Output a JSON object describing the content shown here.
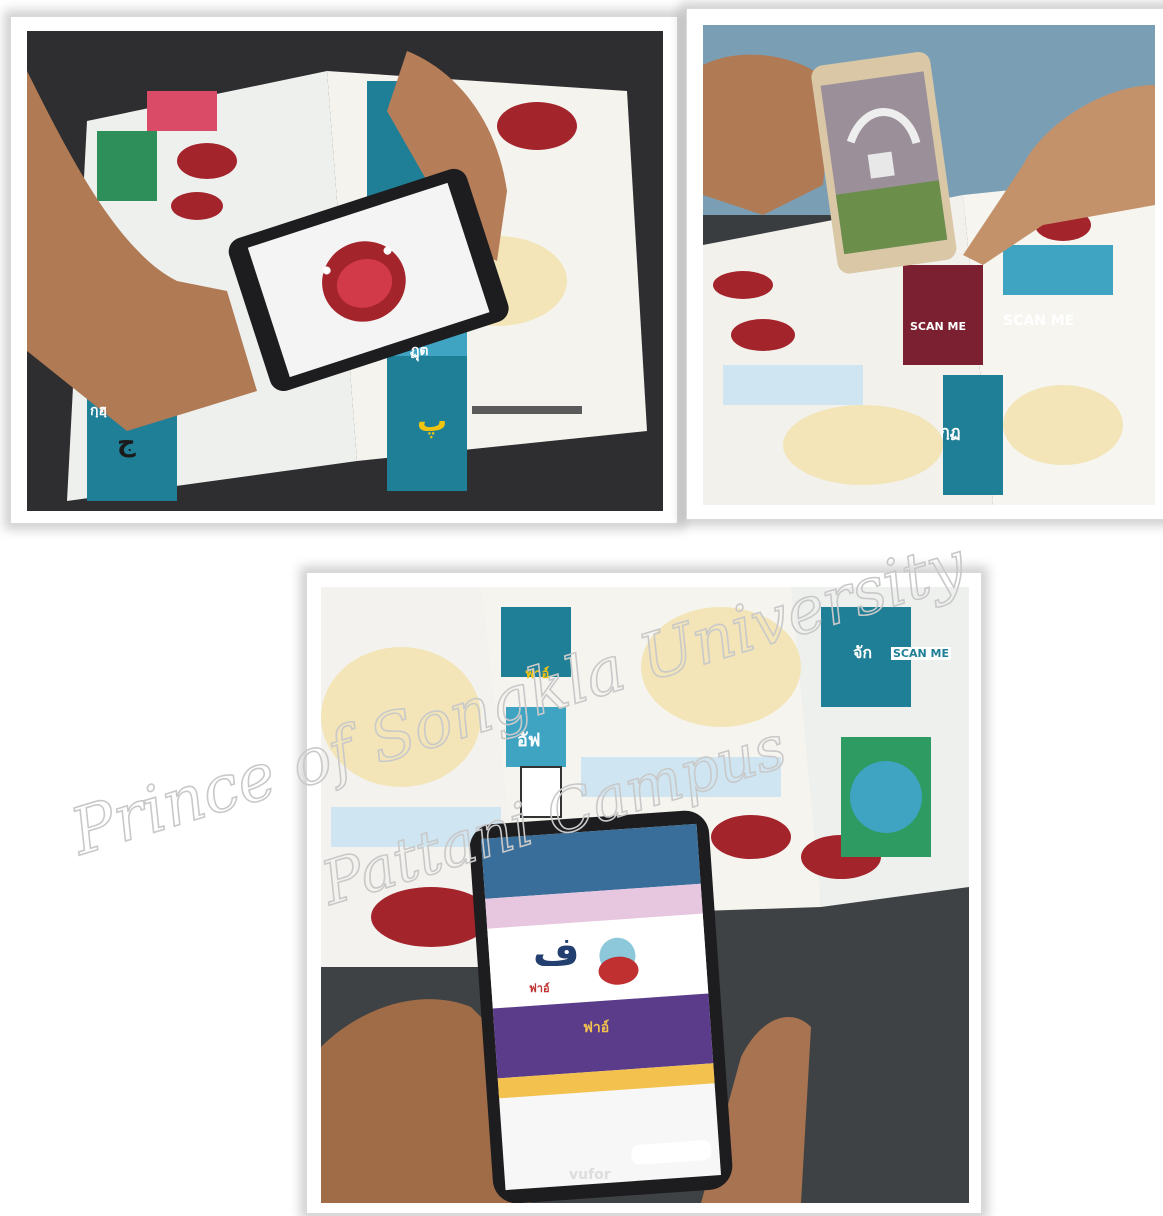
{
  "photos": [
    {
      "id": "photo-top-left",
      "subject": "hands holding a smartphone scanning an open Arabic letters book, phone screen showing an AR model of an open mouth",
      "book_letter_labels": [
        "กฺฮฺ",
        "ฏุต"
      ]
    },
    {
      "id": "photo-top-right",
      "subject": "hand pointing at a smartphone scanning a book page with mouth illustrations",
      "book_labels": [
        "SCAN ME",
        "กฺฏ"
      ]
    },
    {
      "id": "photo-bottom",
      "subject": "hand holding a smartphone showing an AR card of the Arabic letter fa over an open book",
      "book_labels": [
        "ฟาอ์",
        "อัฟ",
        "จัก",
        "SCAN ME"
      ],
      "phone_screen_letter": "ف",
      "phone_screen_caption": "ฟาอ์",
      "phone_screen_banner": "ฟาอ์",
      "phone_brand": "vufor"
    }
  ],
  "watermark": {
    "line1": "Prince of Songkla University",
    "line2": "Pattani Campus"
  },
  "colors": {
    "book_page": "#f2f1ec",
    "book_teal": "#1f7f97",
    "book_green": "#2e9b62",
    "mouth_red": "#a4242c",
    "phone_body": "#1d1d1f",
    "skin": "#b07a55"
  }
}
